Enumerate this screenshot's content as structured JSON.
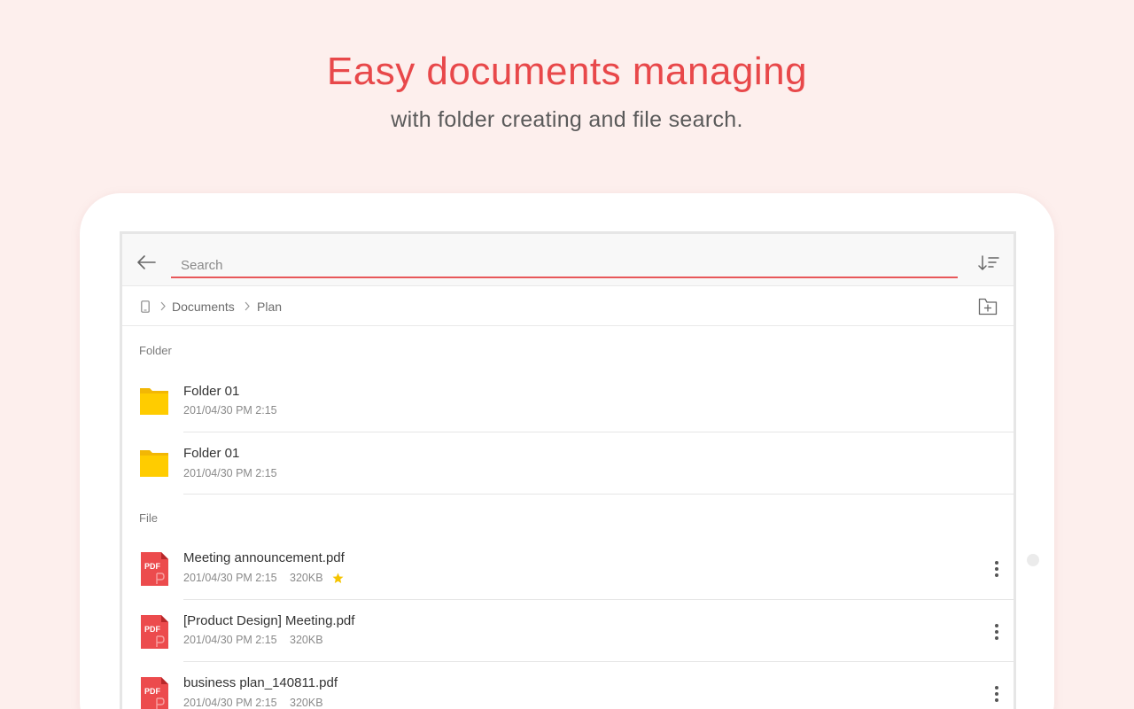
{
  "hero": {
    "title": "Easy documents managing",
    "subtitle": "with folder creating and file search."
  },
  "search": {
    "placeholder": "Search",
    "value": ""
  },
  "breadcrumb": {
    "items": [
      "Documents",
      "Plan"
    ]
  },
  "sections": {
    "folder_label": "Folder",
    "file_label": "File"
  },
  "folders": [
    {
      "name": "Folder 01",
      "date": "201/04/30 PM 2:15"
    },
    {
      "name": "Folder 01",
      "date": "201/04/30 PM 2:15"
    }
  ],
  "files": [
    {
      "name": "Meeting announcement.pdf",
      "date": "201/04/30 PM 2:15",
      "size": "320KB",
      "starred": true,
      "type_label": "PDF"
    },
    {
      "name": "[Product Design] Meeting.pdf",
      "date": "201/04/30 PM 2:15",
      "size": "320KB",
      "starred": false,
      "type_label": "PDF"
    },
    {
      "name": "business plan_140811.pdf",
      "date": "201/04/30 PM 2:15",
      "size": "320KB",
      "starred": false,
      "type_label": "PDF"
    }
  ],
  "icons": {
    "back": "arrow-left-icon",
    "sort": "sort-icon",
    "device": "phone-icon",
    "new_folder": "folder-plus-icon",
    "folder": "folder-icon",
    "pdf": "pdf-file-icon",
    "star": "star-icon",
    "more": "more-vertical-icon"
  },
  "colors": {
    "background": "#fdefed",
    "accent": "#e8484a",
    "folder": "#ffcc00",
    "pdf": "#ec4b4d",
    "star": "#f5c400"
  }
}
